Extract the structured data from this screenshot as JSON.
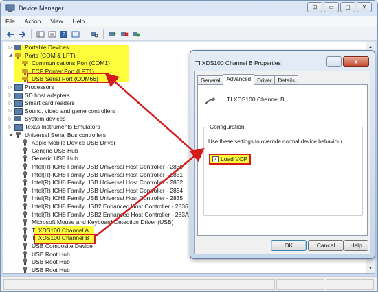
{
  "window": {
    "title": "Device Manager",
    "controls": [
      "⊡",
      "▭",
      "▢",
      "✕"
    ]
  },
  "menu": [
    "File",
    "Action",
    "View",
    "Help"
  ],
  "tree": {
    "rows": [
      {
        "label": "Portable Devices",
        "indent": 1,
        "exp": "▷",
        "icon": "folder-icon"
      },
      {
        "label": "Ports (COM & LPT)",
        "indent": 1,
        "exp": "◢",
        "icon": "port-icon"
      },
      {
        "label": "Communications Port (COM1)",
        "indent": 2,
        "exp": "",
        "icon": "port-icon"
      },
      {
        "label": "ECP Printer Port (LPT1)",
        "indent": 2,
        "exp": "",
        "icon": "port-icon"
      },
      {
        "label": "USB Serial Port (COM66)",
        "indent": 2,
        "exp": "",
        "icon": "port-icon"
      },
      {
        "label": "Processors",
        "indent": 1,
        "exp": "▷",
        "icon": "device-icon"
      },
      {
        "label": "SD host adapters",
        "indent": 1,
        "exp": "▷",
        "icon": "device-icon"
      },
      {
        "label": "Smart card readers",
        "indent": 1,
        "exp": "▷",
        "icon": "device-icon"
      },
      {
        "label": "Sound, video and game controllers",
        "indent": 1,
        "exp": "▷",
        "icon": "device-icon"
      },
      {
        "label": "System devices",
        "indent": 1,
        "exp": "▷",
        "icon": "folder-icon"
      },
      {
        "label": "Texas Instruments Emulators",
        "indent": 1,
        "exp": "▷",
        "icon": "device-icon"
      },
      {
        "label": "Universal Serial Bus controllers",
        "indent": 1,
        "exp": "◢",
        "icon": "usb-icon"
      },
      {
        "label": "Apple Mobile Device USB Driver",
        "indent": 2,
        "exp": "",
        "icon": "usb-icon"
      },
      {
        "label": "Generic USB Hub",
        "indent": 2,
        "exp": "",
        "icon": "usb-icon"
      },
      {
        "label": "Generic USB Hub",
        "indent": 2,
        "exp": "",
        "icon": "usb-icon"
      },
      {
        "label": "Intel(R) ICH8 Family USB Universal Host Controller - 2830",
        "indent": 2,
        "exp": "",
        "icon": "usb-icon"
      },
      {
        "label": "Intel(R) ICH8 Family USB Universal Host Controller - 2831",
        "indent": 2,
        "exp": "",
        "icon": "usb-icon"
      },
      {
        "label": "Intel(R) ICH8 Family USB Universal Host Controller - 2832",
        "indent": 2,
        "exp": "",
        "icon": "usb-icon"
      },
      {
        "label": "Intel(R) ICH8 Family USB Universal Host Controller - 2834",
        "indent": 2,
        "exp": "",
        "icon": "usb-icon"
      },
      {
        "label": "Intel(R) ICH8 Family USB Universal Host Controller - 2835",
        "indent": 2,
        "exp": "",
        "icon": "usb-icon"
      },
      {
        "label": "Intel(R) ICH8 Family USB2 Enhanced Host Controller - 2836",
        "indent": 2,
        "exp": "",
        "icon": "usb-icon"
      },
      {
        "label": "Intel(R) ICH8 Family USB2 Enhanced Host Controller - 283A",
        "indent": 2,
        "exp": "",
        "icon": "usb-icon"
      },
      {
        "label": "Microsoft Mouse and Keyboard Detection Driver (USB)",
        "indent": 2,
        "exp": "",
        "icon": "usb-icon"
      },
      {
        "label": "TI XDS100 Channel A",
        "indent": 2,
        "exp": "",
        "icon": "usb-icon"
      },
      {
        "label": "TI XDS100 Channel B",
        "indent": 2,
        "exp": "",
        "icon": "usb-icon"
      },
      {
        "label": "USB Composite Device",
        "indent": 2,
        "exp": "",
        "icon": "usb-icon"
      },
      {
        "label": "USB Root Hub",
        "indent": 2,
        "exp": "",
        "icon": "usb-icon"
      },
      {
        "label": "USB Root Hub",
        "indent": 2,
        "exp": "",
        "icon": "usb-icon"
      },
      {
        "label": "USB Root Hub",
        "indent": 2,
        "exp": "",
        "icon": "usb-icon"
      }
    ]
  },
  "dialog": {
    "title": "TI XDS100 Channel B Properties",
    "close_label": "x",
    "tabs": [
      "General",
      "Advanced",
      "Driver",
      "Details"
    ],
    "active_tab": "Advanced",
    "device_name": "TI XDS100 Channel B",
    "group_label": "Configuration",
    "group_desc": "Use these settings to override normal device behaviour.",
    "checkbox_label": "Load VCP",
    "checkbox_checked": true,
    "checkbox_mark": "✓",
    "ok_label": "OK",
    "cancel_label": "Cancel",
    "help_label": "Help"
  },
  "colors": {
    "highlight": "#fdfd3c",
    "annotation_red": "#d61a1a"
  }
}
